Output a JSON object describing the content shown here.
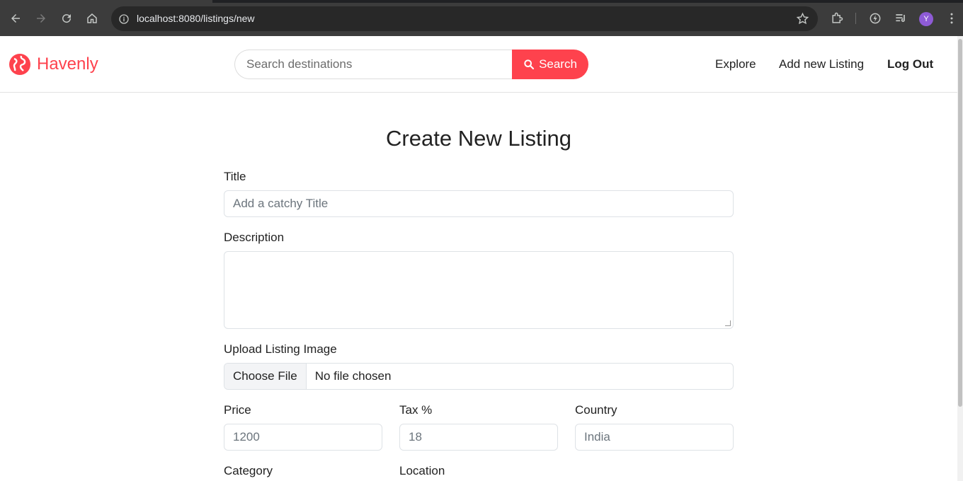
{
  "browser": {
    "url": "localhost:8080/listings/new",
    "profile_initial": "Y"
  },
  "nav": {
    "brand": "Havenly",
    "search_placeholder": "Search destinations",
    "search_button": "Search",
    "links": [
      "Explore",
      "Add new Listing",
      "Log Out"
    ]
  },
  "form": {
    "title": "Create New Listing",
    "title_label": "Title",
    "title_placeholder": "Add a catchy Title",
    "description_label": "Description",
    "image_label": "Upload Listing Image",
    "file_button": "Choose File",
    "file_status": "No file chosen",
    "price_label": "Price",
    "price_value": "1200",
    "tax_label": "Tax %",
    "tax_value": "18",
    "country_label": "Country",
    "country_value": "India",
    "category_label": "Category",
    "location_label": "Location"
  },
  "colors": {
    "brand": "#fe424d",
    "browser_chrome": "#3c3c3c"
  }
}
